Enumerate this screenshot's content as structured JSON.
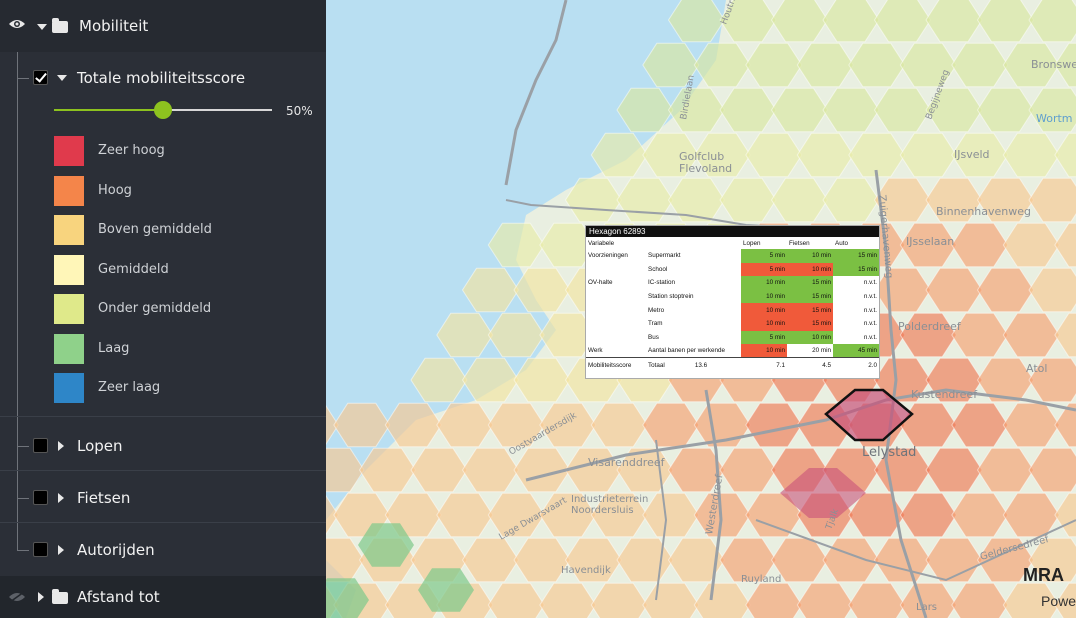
{
  "layer_group": {
    "title": "Mobiliteit"
  },
  "main_layer": {
    "title": "Totale mobiliteitsscore",
    "opacity_label": "50%",
    "opacity": 0.5,
    "checked": true
  },
  "legend": [
    {
      "label": "Zeer hoog",
      "color": "#e03a4c"
    },
    {
      "label": "Hoog",
      "color": "#f4854a"
    },
    {
      "label": "Boven gemiddeld",
      "color": "#f8d47e"
    },
    {
      "label": "Gemiddeld",
      "color": "#fff6b8"
    },
    {
      "label": "Onder gemiddeld",
      "color": "#dfe98a"
    },
    {
      "label": "Laag",
      "color": "#8fd18a"
    },
    {
      "label": "Zeer laag",
      "color": "#2e86c8"
    }
  ],
  "sublayers": [
    {
      "title": "Lopen",
      "checked": false
    },
    {
      "title": "Fietsen",
      "checked": false
    },
    {
      "title": "Autorijden",
      "checked": false
    }
  ],
  "bottom_group": {
    "title": "Afstand tot"
  },
  "map_labels": {
    "golfclub": "Golfclub\nFlevoland",
    "birdielaan": "Birdielaan",
    "zuiderhavenweg": "Zuigerhavenweg",
    "binnenhavenweg": "Binnenhavenweg",
    "ijssellaan": "IJsselaan",
    "begijneweg": "Begijneweg",
    "ijsveld": "IJsveld",
    "bronswe": "Bronswe",
    "wortm": "Wortm",
    "polderdreef": "Polderdreef",
    "atol": "Atol",
    "kustendreef": "Kustendreef",
    "lelystad": "Lelystad",
    "visarenddreef": "Visarenddreef",
    "industrieterrein": "Industrieterrein\nNoordersluis",
    "oostvaardersdijk": "Oostvaardersdijk",
    "lage_dwarsvaart": "Lage Dwarsvaart",
    "havendijk": "Havendijk",
    "westerdreef": "Westerdreef",
    "ruyland": "Ruyland",
    "geldersedreef": "Geldersedreef",
    "lars": "Lars",
    "houtribdijk": "Houtribdijk",
    "tjalk": "Tjalk"
  },
  "popup": {
    "title": "Hexagon 62893",
    "headers": [
      "Variabele",
      "",
      "Lopen",
      "Fietsen",
      "Auto"
    ],
    "rows": [
      {
        "group": "Voorzieningen",
        "item": "Supermarkt",
        "lopen": "5 min",
        "fietsen": "10 min",
        "auto": "15 min",
        "colors": [
          "green",
          "green",
          "green"
        ]
      },
      {
        "group": "",
        "item": "School",
        "lopen": "5 min",
        "fietsen": "10 min",
        "auto": "15 min",
        "colors": [
          "red",
          "red",
          "green"
        ]
      },
      {
        "group": "OV-halte",
        "item": "IC-station",
        "lopen": "10 min",
        "fietsen": "15 min",
        "auto": "n.v.t.",
        "colors": [
          "green",
          "green",
          "white"
        ]
      },
      {
        "group": "",
        "item": "Station stoptrein",
        "lopen": "10 min",
        "fietsen": "15 min",
        "auto": "n.v.t.",
        "colors": [
          "green",
          "green",
          "white"
        ]
      },
      {
        "group": "",
        "item": "Metro",
        "lopen": "10 min",
        "fietsen": "15 min",
        "auto": "n.v.t.",
        "colors": [
          "red",
          "red",
          "white"
        ]
      },
      {
        "group": "",
        "item": "Tram",
        "lopen": "10 min",
        "fietsen": "15 min",
        "auto": "n.v.t.",
        "colors": [
          "red",
          "red",
          "white"
        ]
      },
      {
        "group": "",
        "item": "Bus",
        "lopen": "5 min",
        "fietsen": "10 min",
        "auto": "n.v.t.",
        "colors": [
          "green",
          "green",
          "white"
        ]
      },
      {
        "group": "Werk",
        "item": "Aantal banen per werkende",
        "lopen": "10 min",
        "fietsen": "20 min",
        "auto": "45 min",
        "colors": [
          "red",
          "white",
          "green"
        ]
      }
    ],
    "total": {
      "label": "Mobiliteitsscore",
      "item": "Totaal",
      "overall": "13.6",
      "lopen": "7.1",
      "fietsen": "4.5",
      "auto": "2.0"
    }
  },
  "brand": {
    "name": "MRA",
    "sub": "Powe"
  }
}
